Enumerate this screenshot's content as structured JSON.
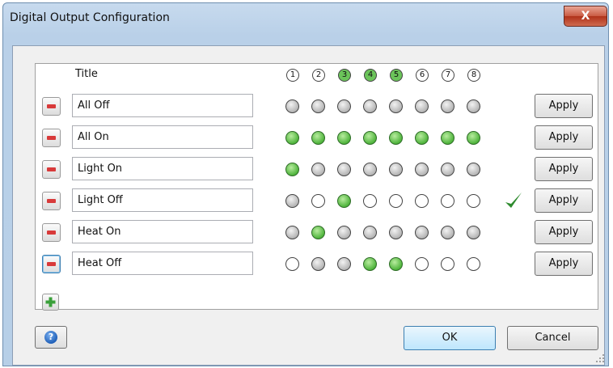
{
  "window": {
    "title": "Digital Output Configuration",
    "close_label": "X"
  },
  "header": {
    "title_label": "Title",
    "channels": [
      "1",
      "2",
      "3",
      "4",
      "5",
      "6",
      "7",
      "8"
    ],
    "channel_on": [
      false,
      false,
      true,
      true,
      true,
      false,
      false,
      false
    ]
  },
  "rows": [
    {
      "name": "All Off",
      "states": [
        "gray",
        "gray",
        "gray",
        "gray",
        "gray",
        "gray",
        "gray",
        "gray"
      ],
      "checked": false,
      "apply_label": "Apply",
      "focused": false
    },
    {
      "name": "All On",
      "states": [
        "green",
        "green",
        "green",
        "green",
        "green",
        "green",
        "green",
        "green"
      ],
      "checked": false,
      "apply_label": "Apply",
      "focused": false
    },
    {
      "name": "Light On",
      "states": [
        "green",
        "gray",
        "gray",
        "gray",
        "gray",
        "gray",
        "gray",
        "gray"
      ],
      "checked": false,
      "apply_label": "Apply",
      "focused": false
    },
    {
      "name": "Light Off",
      "states": [
        "gray",
        "white",
        "green",
        "white",
        "white",
        "white",
        "white",
        "white"
      ],
      "checked": true,
      "apply_label": "Apply",
      "focused": false
    },
    {
      "name": "Heat On",
      "states": [
        "gray",
        "green",
        "gray",
        "gray",
        "gray",
        "gray",
        "gray",
        "gray"
      ],
      "checked": false,
      "apply_label": "Apply",
      "focused": false
    },
    {
      "name": "Heat Off",
      "states": [
        "white",
        "gray",
        "gray",
        "green",
        "green",
        "white",
        "white",
        "white"
      ],
      "checked": false,
      "apply_label": "Apply",
      "focused": true
    }
  ],
  "footer": {
    "ok_label": "OK",
    "cancel_label": "Cancel",
    "help_glyph": "?"
  },
  "colors": {
    "led_on": "#4fb43c",
    "led_off": "#b5b5b5",
    "remove_red": "#d83a3a",
    "add_green": "#3aa03a",
    "check_green": "#2e8b2e"
  },
  "icons": {
    "remove": "minus-icon",
    "add": "plus-icon",
    "help": "help-icon",
    "applied": "checkmark-icon"
  }
}
